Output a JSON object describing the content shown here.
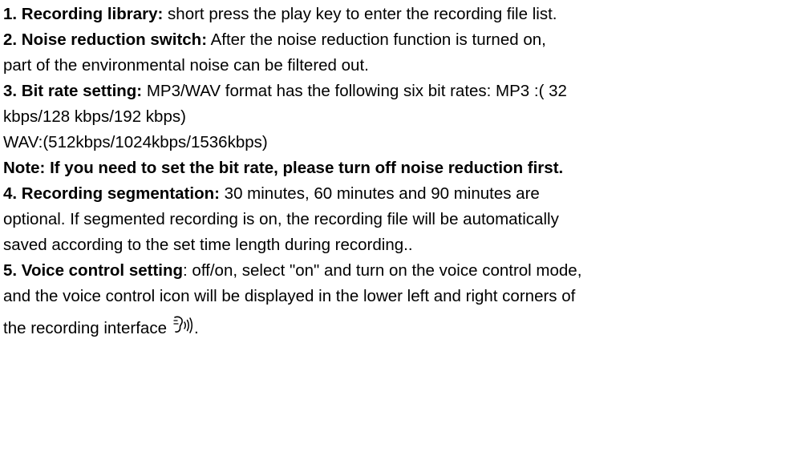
{
  "items": [
    {
      "id": 1,
      "title": "1. Recording library:",
      "lines": [
        " short press the play key to enter the recording file list."
      ]
    },
    {
      "id": 2,
      "title": "2. Noise reduction switch:",
      "lines": [
        " After the noise reduction function is turned on,",
        "part of the environmental noise can be filtered out."
      ]
    },
    {
      "id": 3,
      "title": "3. Bit rate setting:",
      "lines": [
        " MP3/WAV format has the following six bit rates: MP3 :( 32",
        "kbps/128 kbps/192 kbps)",
        "WAV:(512kbps/1024kbps/1536kbps)"
      ]
    },
    {
      "id": "note",
      "text": "Note: If you need to set the bit rate, please turn off noise reduction first."
    },
    {
      "id": 4,
      "title": "4. Recording segmentation:",
      "lines": [
        " 30 minutes, 60 minutes and 90 minutes are",
        "optional. If segmented recording is on, the recording file will be automatically",
        "saved according to the set time length during recording.."
      ]
    },
    {
      "id": 5,
      "title": "5. Voice control setting",
      "lines": [
        ": off/on, select \"on\" and turn on the voice control mode,",
        "and the voice control icon will be displayed in the lower left and right corners of",
        "the recording interface",
        "."
      ],
      "icon": "voice-control-icon"
    }
  ]
}
